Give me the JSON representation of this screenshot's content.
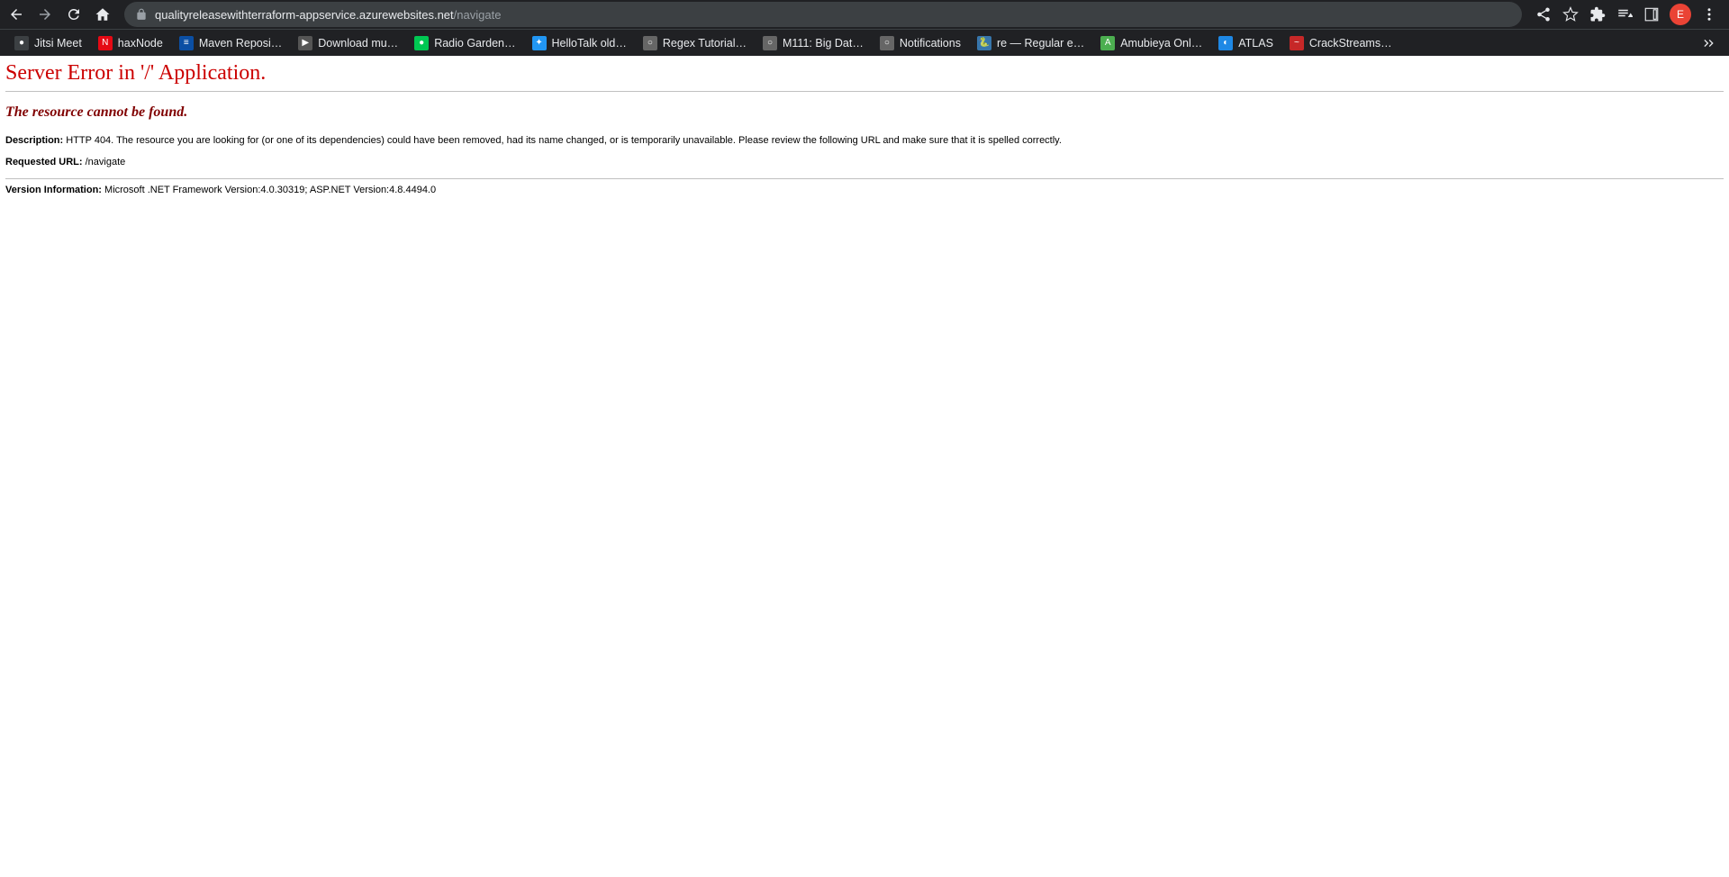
{
  "nav": {
    "url_host": "qualityreleasewithterraform-appservice.azurewebsites.net",
    "url_path": "/navigate"
  },
  "avatar": {
    "initial": "E"
  },
  "bookmarks": [
    {
      "label": "Jitsi Meet",
      "fav_bg": "#3c4043",
      "fav_color": "#fff",
      "fav_text": "●"
    },
    {
      "label": "haxNode",
      "fav_bg": "#e50914",
      "fav_color": "#fff",
      "fav_text": "N"
    },
    {
      "label": "Maven Reposi…",
      "fav_bg": "#0b4fa4",
      "fav_color": "#fff",
      "fav_text": "≡"
    },
    {
      "label": "Download mu…",
      "fav_bg": "#555",
      "fav_color": "#fff",
      "fav_text": "▶"
    },
    {
      "label": "Radio Garden…",
      "fav_bg": "#00c853",
      "fav_color": "#fff",
      "fav_text": "●"
    },
    {
      "label": "HelloTalk old…",
      "fav_bg": "#2196f3",
      "fav_color": "#fff",
      "fav_text": "✦"
    },
    {
      "label": "Regex Tutorial…",
      "fav_bg": "#666",
      "fav_color": "#fff",
      "fav_text": "○"
    },
    {
      "label": "M111: Big Dat…",
      "fav_bg": "#666",
      "fav_color": "#fff",
      "fav_text": "○"
    },
    {
      "label": "Notifications",
      "fav_bg": "#666",
      "fav_color": "#fff",
      "fav_text": "○"
    },
    {
      "label": "re — Regular e…",
      "fav_bg": "#3776ab",
      "fav_color": "#ffd43b",
      "fav_text": "🐍"
    },
    {
      "label": "Amubieya Onl…",
      "fav_bg": "#4caf50",
      "fav_color": "#fff",
      "fav_text": "A"
    },
    {
      "label": "ATLAS",
      "fav_bg": "#1e88e5",
      "fav_color": "#fff",
      "fav_text": "◐"
    },
    {
      "label": "CrackStreams…",
      "fav_bg": "#c62828",
      "fav_color": "#fff",
      "fav_text": "~"
    }
  ],
  "errorPage": {
    "header": "Server Error in '/' Application.",
    "sub": "The resource cannot be found.",
    "descLabel": "Description:",
    "descText": " HTTP 404. The resource you are looking for (or one of its dependencies) could have been removed, had its name changed, or is temporarily unavailable.  Please review the following URL and make sure that it is spelled correctly.",
    "reqLabel": "Requested URL:",
    "reqText": " /navigate",
    "versionLabel": "Version Information:",
    "versionText": " Microsoft .NET Framework Version:4.0.30319; ASP.NET Version:4.8.4494.0"
  }
}
